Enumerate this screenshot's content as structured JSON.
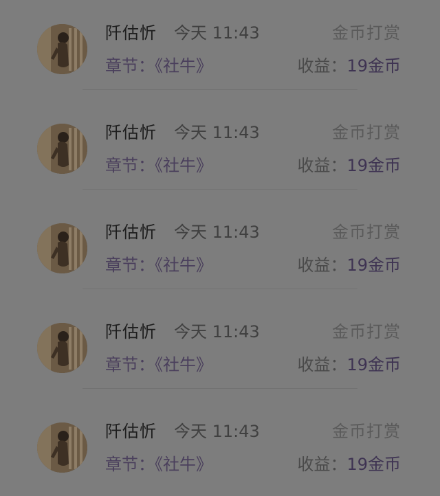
{
  "rows": [
    {
      "name": "阡估忻",
      "time": "今天 11:43",
      "type": "金币打赏",
      "chapter_label": "章节：",
      "chapter": "《社牛》",
      "earn_label": "收益：",
      "earn_amount": "19金币"
    },
    {
      "name": "阡估忻",
      "time": "今天 11:43",
      "type": "金币打赏",
      "chapter_label": "章节：",
      "chapter": "《社牛》",
      "earn_label": "收益：",
      "earn_amount": "19金币"
    },
    {
      "name": "阡估忻",
      "time": "今天 11:43",
      "type": "金币打赏",
      "chapter_label": "章节：",
      "chapter": "《社牛》",
      "earn_label": "收益：",
      "earn_amount": "19金币"
    },
    {
      "name": "阡估忻",
      "time": "今天 11:43",
      "type": "金币打赏",
      "chapter_label": "章节：",
      "chapter": "《社牛》",
      "earn_label": "收益：",
      "earn_amount": "19金币"
    },
    {
      "name": "阡估忻",
      "time": "今天 11:43",
      "type": "金币打赏",
      "chapter_label": "章节：",
      "chapter": "《社牛》",
      "earn_label": "收益：",
      "earn_amount": "19金币"
    }
  ],
  "colors": {
    "background": "#7d7d7d",
    "name": "#1e1e1e",
    "accent_purple": "#4a3f5c"
  },
  "icons": {
    "avatar": "user-photo-avatar"
  }
}
